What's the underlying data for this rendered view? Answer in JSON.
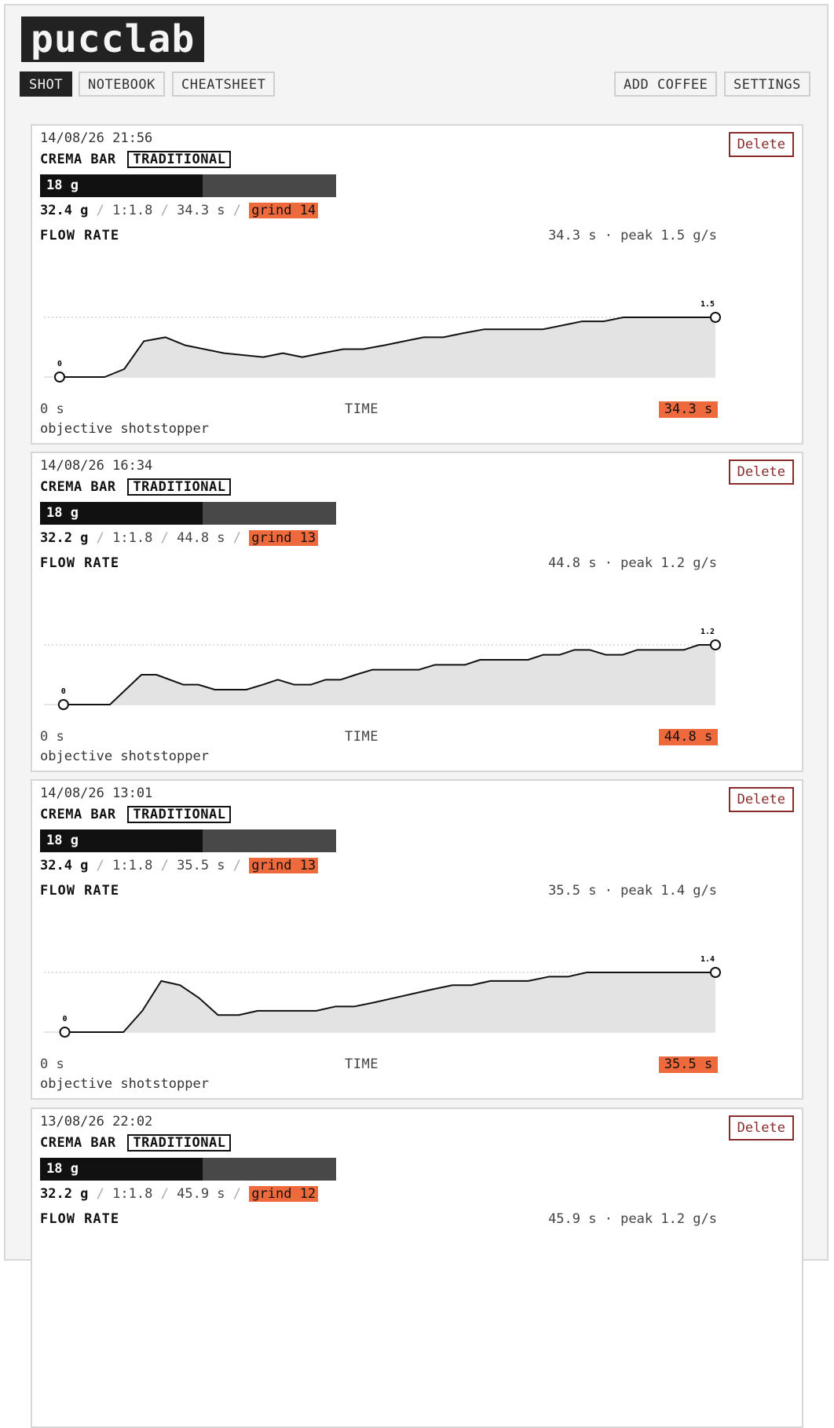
{
  "app": {
    "logo": "pucclab"
  },
  "nav": {
    "left": [
      "SHOT",
      "NOTEBOOK",
      "CHEATSHEET"
    ],
    "right": [
      "ADD COFFEE",
      "SETTINGS"
    ],
    "active": "SHOT"
  },
  "shots": [
    {
      "date": "14/08/26 21:56",
      "coffee": "CREMA BAR",
      "style": "TRADITIONAL",
      "dose": "18 g",
      "dose_fraction": 0.55,
      "yield": "32.4 g",
      "ratio": "1:1.8",
      "time": "34.3 s",
      "grind": "grind 14",
      "chart_title": "FLOW RATE",
      "summary": "34.3 s · peak 1.5 g/s",
      "axis_start": "0 s",
      "axis_label": "TIME",
      "axis_end": "34.3 s",
      "notes": "objective shotstopper",
      "delete_label": "Delete",
      "start_label": "0",
      "peak_label": "1.5",
      "chart_data": {
        "type": "area",
        "xlabel": "TIME",
        "ylim": [
          0,
          1.5
        ],
        "xlim": [
          0,
          34.3
        ],
        "x": [
          0.8,
          3.1,
          4.1,
          5.1,
          6.2,
          7.2,
          9.2,
          11.2,
          12.2,
          13.2,
          14.2,
          15.3,
          16.3,
          17.4,
          18.4,
          19.4,
          20.4,
          21.4,
          22.5,
          23.5,
          24.5,
          25.5,
          26.5,
          27.5,
          28.6,
          29.6,
          30.6,
          32.6,
          34.3
        ],
        "y": [
          0,
          0,
          0.2,
          0.9,
          1.0,
          0.8,
          0.6,
          0.5,
          0.6,
          0.5,
          0.6,
          0.7,
          0.7,
          0.8,
          0.9,
          1.0,
          1.0,
          1.1,
          1.2,
          1.2,
          1.2,
          1.2,
          1.3,
          1.4,
          1.4,
          1.5,
          1.5,
          1.5,
          1.5
        ]
      }
    },
    {
      "date": "14/08/26 16:34",
      "coffee": "CREMA BAR",
      "style": "TRADITIONAL",
      "dose": "18 g",
      "dose_fraction": 0.55,
      "yield": "32.2 g",
      "ratio": "1:1.8",
      "time": "44.8 s",
      "grind": "grind 13",
      "chart_title": "FLOW RATE",
      "summary": "44.8 s · peak 1.2 g/s",
      "axis_start": "0 s",
      "axis_label": "TIME",
      "axis_end": "44.8 s",
      "notes": "objective shotstopper",
      "delete_label": "Delete",
      "start_label": "0",
      "peak_label": "1.2",
      "chart_data": {
        "type": "area",
        "xlabel": "TIME",
        "ylim": [
          0,
          1.2
        ],
        "xlim": [
          0,
          44.8
        ],
        "x": [
          1.3,
          4.4,
          6.5,
          7.5,
          9.3,
          10.3,
          11.4,
          12.4,
          13.5,
          14.6,
          15.6,
          16.7,
          17.8,
          18.8,
          19.8,
          20.8,
          21.9,
          23.0,
          24.0,
          25.0,
          26.1,
          27.1,
          28.1,
          29.1,
          30.2,
          31.2,
          32.3,
          33.3,
          34.4,
          35.4,
          36.4,
          37.5,
          38.6,
          39.6,
          40.6,
          41.7,
          42.7,
          43.7,
          44.8
        ],
        "y": [
          0,
          0,
          0.6,
          0.6,
          0.4,
          0.4,
          0.3,
          0.3,
          0.3,
          0.4,
          0.5,
          0.4,
          0.4,
          0.5,
          0.5,
          0.6,
          0.7,
          0.7,
          0.7,
          0.7,
          0.8,
          0.8,
          0.8,
          0.9,
          0.9,
          0.9,
          0.9,
          1.0,
          1.0,
          1.1,
          1.1,
          1.0,
          1.0,
          1.1,
          1.1,
          1.1,
          1.1,
          1.2,
          1.2
        ]
      }
    },
    {
      "date": "14/08/26 13:01",
      "coffee": "CREMA BAR",
      "style": "TRADITIONAL",
      "dose": "18 g",
      "dose_fraction": 0.55,
      "yield": "32.4 g",
      "ratio": "1:1.8",
      "time": "35.5 s",
      "grind": "grind 13",
      "chart_title": "FLOW RATE",
      "summary": "35.5 s · peak 1.4 g/s",
      "axis_start": "0 s",
      "axis_label": "TIME",
      "axis_end": "35.5 s",
      "notes": "objective shotstopper",
      "delete_label": "Delete",
      "start_label": "0",
      "peak_label": "1.4",
      "chart_data": {
        "type": "area",
        "xlabel": "TIME",
        "ylim": [
          0,
          1.4
        ],
        "xlim": [
          0,
          35.5
        ],
        "x": [
          1.1,
          4.2,
          5.2,
          6.2,
          7.2,
          8.2,
          9.2,
          10.3,
          11.3,
          12.3,
          13.3,
          14.4,
          15.4,
          16.4,
          17.5,
          18.5,
          19.5,
          20.5,
          21.6,
          22.6,
          23.6,
          24.6,
          25.6,
          26.7,
          27.7,
          28.7,
          29.8,
          34.4,
          35.5
        ],
        "y": [
          0,
          0,
          0.5,
          1.2,
          1.1,
          0.8,
          0.4,
          0.4,
          0.5,
          0.5,
          0.5,
          0.5,
          0.6,
          0.6,
          0.7,
          0.8,
          0.9,
          1.0,
          1.1,
          1.1,
          1.2,
          1.2,
          1.2,
          1.3,
          1.3,
          1.4,
          1.4,
          1.4,
          1.4
        ]
      }
    },
    {
      "date": "13/08/26 22:02",
      "coffee": "CREMA BAR",
      "style": "TRADITIONAL",
      "dose": "18 g",
      "dose_fraction": 0.55,
      "yield": "32.2 g",
      "ratio": "1:1.8",
      "time": "45.9 s",
      "grind": "grind 12",
      "chart_title": "FLOW RATE",
      "summary": "45.9 s · peak 1.2 g/s",
      "delete_label": "Delete"
    }
  ]
}
